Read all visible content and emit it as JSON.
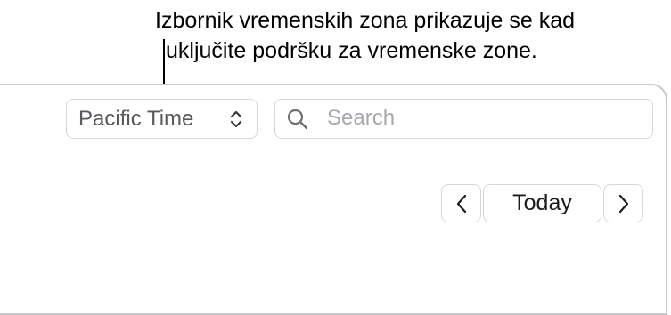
{
  "callout": {
    "line1": "Izbornik vremenskih zona prikazuje se kad",
    "line2": "uključite podršku za vremenske zone."
  },
  "toolbar": {
    "timezone_selected": "Pacific Time",
    "search_placeholder": "Search",
    "search_value": ""
  },
  "navigation": {
    "today_label": "Today"
  },
  "icons": {
    "timezone_chevron": "chevron-up-down-icon",
    "search": "search-icon",
    "previous": "chevron-left-icon",
    "next": "chevron-right-icon"
  },
  "colors": {
    "border": "#d8d8dc",
    "window_border": "#c7c7cc",
    "placeholder": "#a8a8ad",
    "label_gray": "#5a5a5e"
  }
}
